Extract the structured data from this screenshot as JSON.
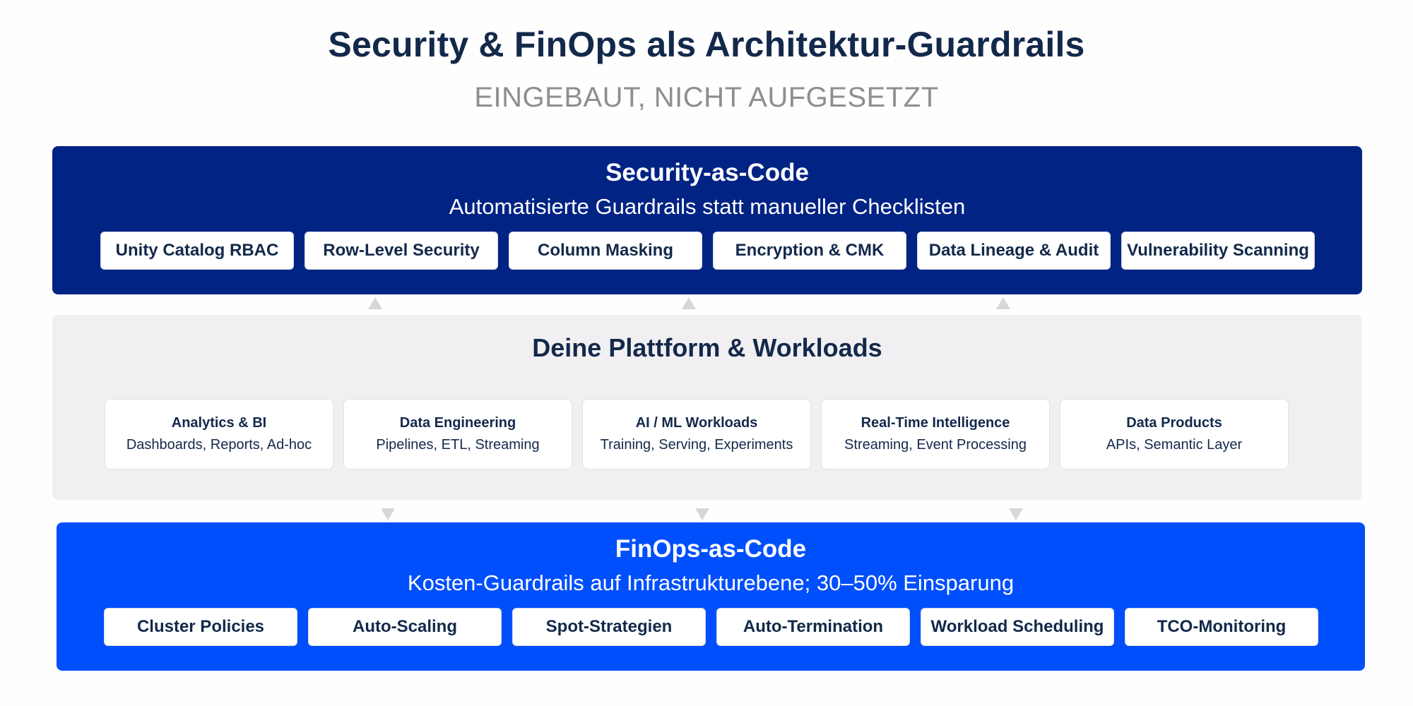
{
  "header": {
    "title": "Security & FinOps als Architektur-Guardrails",
    "subtitle": "EINGEBAUT, NICHT AUFGESETZT"
  },
  "security": {
    "title": "Security-as-Code",
    "description": "Automatisierte Guardrails statt manueller Checklisten",
    "items": [
      {
        "label": "Unity Catalog RBAC"
      },
      {
        "label": "Row-Level Security"
      },
      {
        "label": "Column Masking"
      },
      {
        "label": "Encryption & CMK"
      },
      {
        "label": "Data Lineage & Audit"
      },
      {
        "label": "Vulnerability Scanning"
      }
    ]
  },
  "platform": {
    "title": "Deine Plattform & Workloads",
    "cards": [
      {
        "title": "Analytics & BI",
        "desc": "Dashboards, Reports, Ad-hoc"
      },
      {
        "title": "Data Engineering",
        "desc": "Pipelines, ETL, Streaming"
      },
      {
        "title": "AI / ML Workloads",
        "desc": "Training, Serving, Experiments"
      },
      {
        "title": "Real-Time Intelligence",
        "desc": "Streaming, Event Processing"
      },
      {
        "title": "Data Products",
        "desc": "APIs, Semantic Layer"
      }
    ]
  },
  "finops": {
    "title": "FinOps-as-Code",
    "description": "Kosten-Guardrails auf Infrastrukturebene; 30–50% Einsparung",
    "items": [
      {
        "label": "Cluster Policies"
      },
      {
        "label": "Auto-Scaling"
      },
      {
        "label": "Spot-Strategien"
      },
      {
        "label": "Auto-Termination"
      },
      {
        "label": "Workload Scheduling"
      },
      {
        "label": "TCO-Monitoring"
      }
    ]
  },
  "colors": {
    "security_band": "#002384",
    "platform_band": "#f1eff1",
    "finops_band": "#004ffc",
    "text_dark": "#13294b",
    "subtitle_gray": "#8e8e92",
    "arrow_gray": "#d7d7db"
  }
}
